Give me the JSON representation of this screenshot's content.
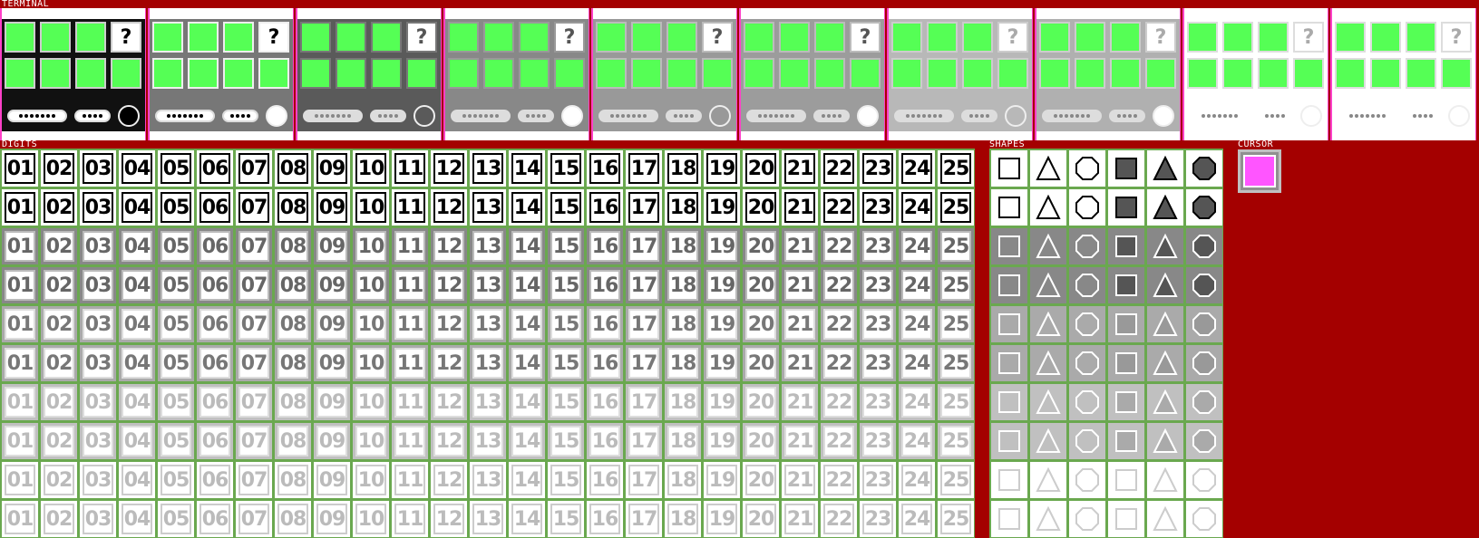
{
  "sections": {
    "terminal": "TERMINAL",
    "digits": "DIGITS",
    "shapes": "SHAPES",
    "cursor": "CURSOR"
  },
  "terminal": {
    "key_question": "?",
    "panel_count": 10
  },
  "digits": [
    "01",
    "02",
    "03",
    "04",
    "05",
    "06",
    "07",
    "08",
    "09",
    "10",
    "11",
    "12",
    "13",
    "14",
    "15",
    "16",
    "17",
    "18",
    "19",
    "20",
    "21",
    "22",
    "23",
    "24",
    "25"
  ],
  "shapes": [
    "square-outline",
    "triangle-outline",
    "octagon-outline",
    "square-filled",
    "triangle-filled",
    "octagon-filled"
  ],
  "colors": {
    "background": "#a40000",
    "key_green": "#55ff55",
    "cursor_pink": "#ff55ff",
    "panel_border": "#ff40c8",
    "tile_grid": "#6aa84f"
  }
}
